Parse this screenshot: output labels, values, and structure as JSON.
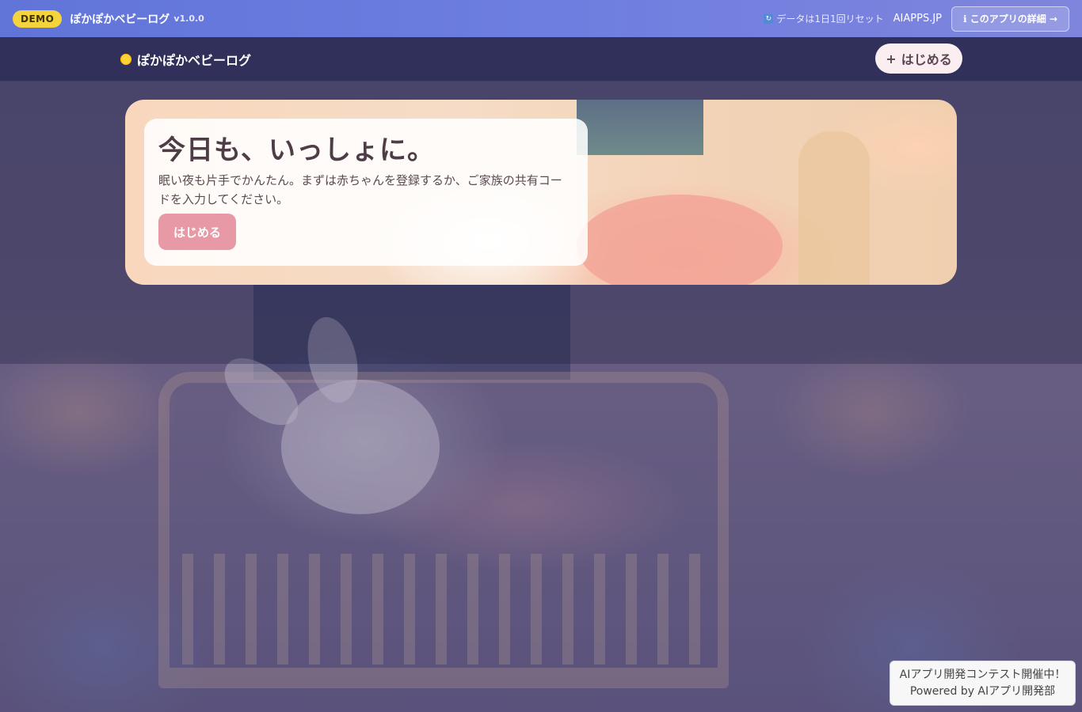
{
  "demo_bar": {
    "badge": "DEMO",
    "app_name": "ぽかぽかベビーログ",
    "version": "v1.0.0",
    "reset_icon": "refresh-icon",
    "reset_note": "データは1日1回リセット",
    "site_link": "AIAPPS.JP",
    "details_button": "ℹ このアプリの詳細 →",
    "colors": {
      "bar": "#6174d8",
      "badge": "#f5d33c"
    }
  },
  "header": {
    "logo_icon": "sun-icon",
    "logo_text": "ぽかぽかベビーログ",
    "start_button": "はじめる",
    "start_button_icon": "+"
  },
  "hero": {
    "title": "今日も、いっしょに。",
    "description": "眠い夜も片手でかんたん。まずは赤ちゃんを登録するか、ご家族の共有コードを入力してください。",
    "cta_button": "はじめる",
    "colors": {
      "cta": "#e79aa6"
    }
  },
  "footer_badge": {
    "line1": "AIアプリ開発コンテスト開催中！",
    "line2": "Powered by AIアプリ開発部"
  }
}
